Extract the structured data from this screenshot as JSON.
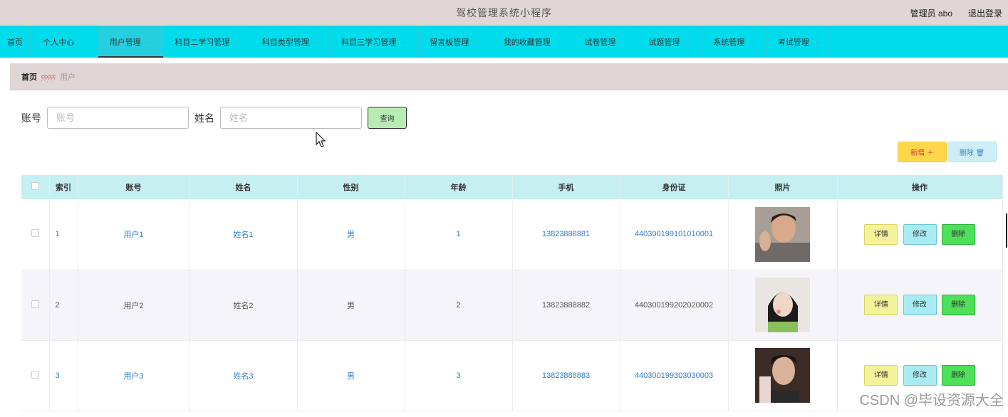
{
  "header": {
    "title": "驾校管理系统小程序",
    "admin_label": "管理员 abo",
    "logout_label": "退出登录"
  },
  "nav": {
    "items": [
      {
        "label": "首页",
        "has_dropdown": false,
        "active": false
      },
      {
        "label": "个人中心",
        "has_dropdown": true,
        "active": false
      },
      {
        "label": "用户管理",
        "has_dropdown": true,
        "active": true
      },
      {
        "label": "科目二学习管理",
        "has_dropdown": true,
        "active": false
      },
      {
        "label": "科目类型管理",
        "has_dropdown": true,
        "active": false
      },
      {
        "label": "科目三学习管理",
        "has_dropdown": true,
        "active": false
      },
      {
        "label": "留言板管理",
        "has_dropdown": true,
        "active": false
      },
      {
        "label": "我的收藏管理",
        "has_dropdown": true,
        "active": false
      },
      {
        "label": "试卷管理",
        "has_dropdown": true,
        "active": false
      },
      {
        "label": "试题管理",
        "has_dropdown": true,
        "active": false
      },
      {
        "label": "系统管理",
        "has_dropdown": true,
        "active": false
      },
      {
        "label": "考试管理",
        "has_dropdown": true,
        "active": false
      }
    ]
  },
  "breadcrumb": {
    "home": "首页",
    "separator": "ççççç",
    "current": "用户"
  },
  "search": {
    "account_label": "账号",
    "account_placeholder": "账号",
    "name_label": "姓名",
    "name_placeholder": "姓名",
    "query_label": "查询"
  },
  "actions": {
    "add_label": "新增 ＋",
    "delete_label": "删除 🗑"
  },
  "table": {
    "headers": [
      "",
      "索引",
      "账号",
      "姓名",
      "性别",
      "年龄",
      "手机",
      "身份证",
      "照片",
      "操作"
    ],
    "rows": [
      {
        "index": "1",
        "account": "用户1",
        "name": "姓名1",
        "gender": "男",
        "age": "1",
        "phone": "13823888881",
        "id_card": "440300199101010001"
      },
      {
        "index": "2",
        "account": "用户2",
        "name": "姓名2",
        "gender": "男",
        "age": "2",
        "phone": "13823888882",
        "id_card": "440300199202020002"
      },
      {
        "index": "3",
        "account": "用户3",
        "name": "姓名3",
        "gender": "男",
        "age": "3",
        "phone": "13823888883",
        "id_card": "440300199303030003"
      }
    ],
    "op_detail": "详情",
    "op_edit": "修改",
    "op_delete": "删除"
  },
  "watermark": "CSDN @毕设资源大全",
  "colors": {
    "header_bg": "#e0d6d6",
    "nav_bg": "#00dceb",
    "table_header_bg": "#c6eff2",
    "link_blue": "#2c7fcf",
    "query_btn": "#b8ecb4",
    "add_btn": "#ffd84a"
  }
}
